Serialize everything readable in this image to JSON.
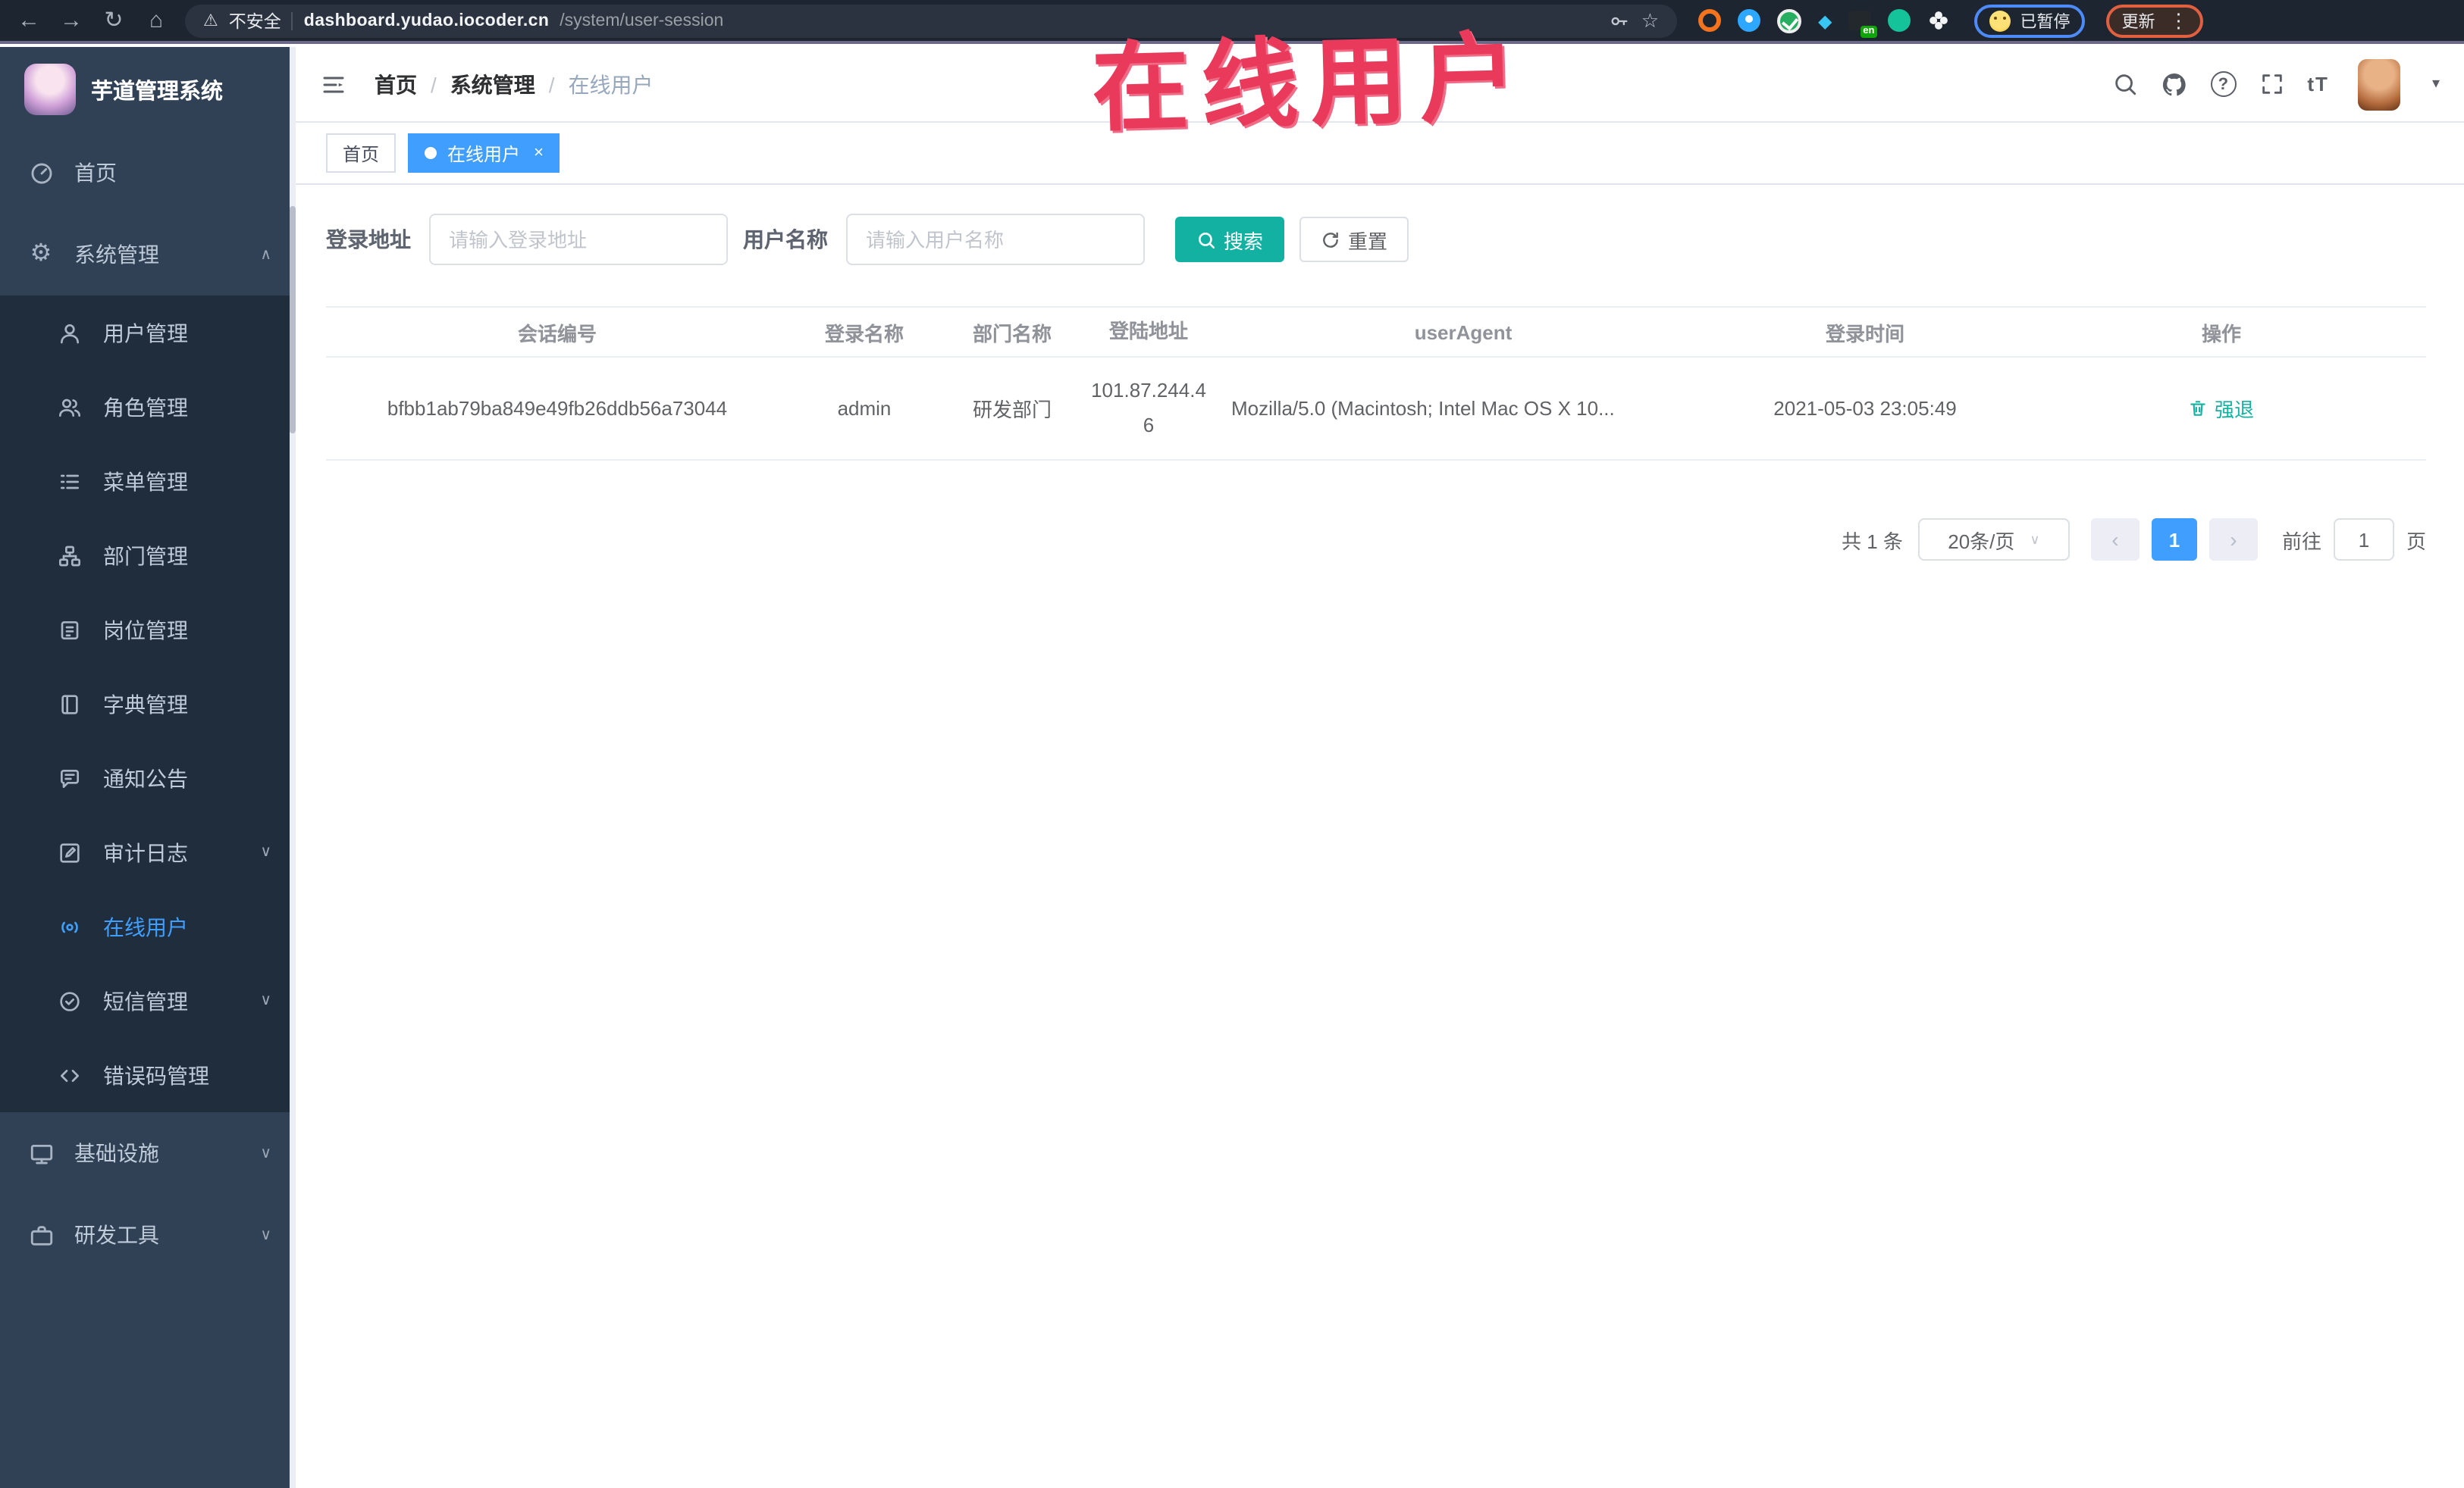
{
  "browser": {
    "security_label": "不安全",
    "url_domain": "dashboard.yudao.iocoder.cn",
    "url_path": "/system/user-session",
    "extension_badge": "en",
    "paused_badge": "已暂停",
    "update_button": "更新"
  },
  "annotation": {
    "text": "在线用户",
    "color": "#e93a5c"
  },
  "sidebar": {
    "logo_title": "芋道管理系统",
    "items": [
      {
        "label": "首页"
      },
      {
        "label": "系统管理",
        "state": "expanded"
      },
      {
        "label": "用户管理"
      },
      {
        "label": "角色管理"
      },
      {
        "label": "菜单管理"
      },
      {
        "label": "部门管理"
      },
      {
        "label": "岗位管理"
      },
      {
        "label": "字典管理"
      },
      {
        "label": "通知公告"
      },
      {
        "label": "审计日志",
        "state": "collapsed"
      },
      {
        "label": "在线用户",
        "state": "active"
      },
      {
        "label": "短信管理",
        "state": "collapsed"
      },
      {
        "label": "错误码管理"
      },
      {
        "label": "基础设施",
        "state": "collapsed"
      },
      {
        "label": "研发工具",
        "state": "collapsed"
      }
    ]
  },
  "header": {
    "breadcrumb": [
      "首页",
      "系统管理",
      "在线用户"
    ],
    "font_size_icon_label": "tT"
  },
  "tabs": [
    {
      "label": "首页"
    },
    {
      "label": "在线用户",
      "active": true
    }
  ],
  "filters": {
    "login_address_label": "登录地址",
    "login_address_placeholder": "请输入登录地址",
    "username_label": "用户名称",
    "username_placeholder": "请输入用户名称",
    "search_button": "搜索",
    "reset_button": "重置"
  },
  "table": {
    "columns": [
      "会话编号",
      "登录名称",
      "部门名称",
      "登陆地址",
      "userAgent",
      "登录时间",
      "操作"
    ],
    "rows": [
      {
        "session_id": "bfbb1ab79ba849e49fb26ddb56a73044",
        "login_name": "admin",
        "dept_name": "研发部门",
        "login_address": "101.87.244.46",
        "user_agent": "Mozilla/5.0 (Macintosh; Intel Mac OS X 10...",
        "login_time": "2021-05-03 23:05:49",
        "action": "强退"
      }
    ]
  },
  "pagination": {
    "total": "共 1 条",
    "page_size": "20条/页",
    "current_page": "1",
    "goto_label": "前往",
    "goto_value": "1",
    "page_unit": "页"
  },
  "colors": {
    "primary": "#409eff",
    "action_teal": "#13b1a2",
    "sidebar_bg": "#304156",
    "submenu_bg": "#1f2d3d",
    "annotation": "#e93a5c"
  }
}
